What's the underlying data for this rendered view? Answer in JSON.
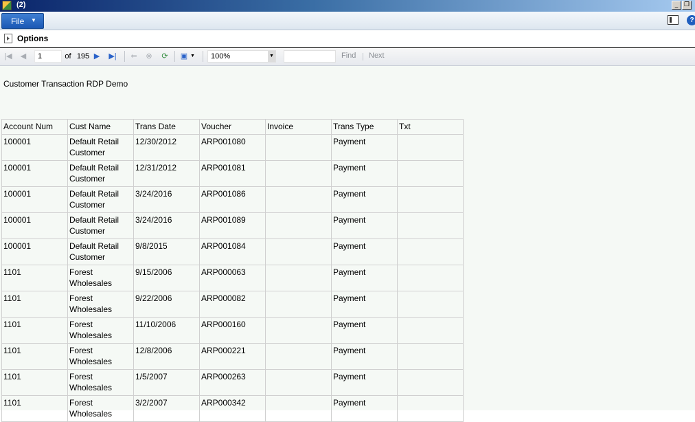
{
  "window": {
    "title": "(2)"
  },
  "menu": {
    "file_label": "File"
  },
  "options": {
    "label": "Options"
  },
  "toolbar": {
    "page_value": "1",
    "of_label": "of",
    "total_pages": "195",
    "zoom_value": "100%",
    "find_label": "Find",
    "next_label": "Next"
  },
  "report": {
    "title": "Customer Transaction RDP Demo",
    "columns": [
      "Account Num",
      "Cust Name",
      "Trans Date",
      "Voucher",
      "Invoice",
      "Trans Type",
      "Txt"
    ],
    "rows": [
      [
        "100001",
        "Default Retail Customer",
        "12/30/2012",
        "ARP001080",
        "",
        "Payment",
        ""
      ],
      [
        "100001",
        "Default Retail Customer",
        "12/31/2012",
        "ARP001081",
        "",
        "Payment",
        ""
      ],
      [
        "100001",
        "Default Retail Customer",
        "3/24/2016",
        "ARP001086",
        "",
        "Payment",
        ""
      ],
      [
        "100001",
        "Default Retail Customer",
        "3/24/2016",
        "ARP001089",
        "",
        "Payment",
        ""
      ],
      [
        "100001",
        "Default Retail Customer",
        "9/8/2015",
        "ARP001084",
        "",
        "Payment",
        ""
      ],
      [
        "1101",
        "Forest Wholesales",
        "9/15/2006",
        "ARP000063",
        "",
        "Payment",
        ""
      ],
      [
        "1101",
        "Forest Wholesales",
        "9/22/2006",
        "ARP000082",
        "",
        "Payment",
        ""
      ],
      [
        "1101",
        "Forest Wholesales",
        "11/10/2006",
        "ARP000160",
        "",
        "Payment",
        ""
      ],
      [
        "1101",
        "Forest Wholesales",
        "12/8/2006",
        "ARP000221",
        "",
        "Payment",
        ""
      ],
      [
        "1101",
        "Forest Wholesales",
        "1/5/2007",
        "ARP000263",
        "",
        "Payment",
        ""
      ],
      [
        "1101",
        "Forest Wholesales",
        "3/2/2007",
        "ARP000342",
        "",
        "Payment",
        ""
      ]
    ]
  }
}
